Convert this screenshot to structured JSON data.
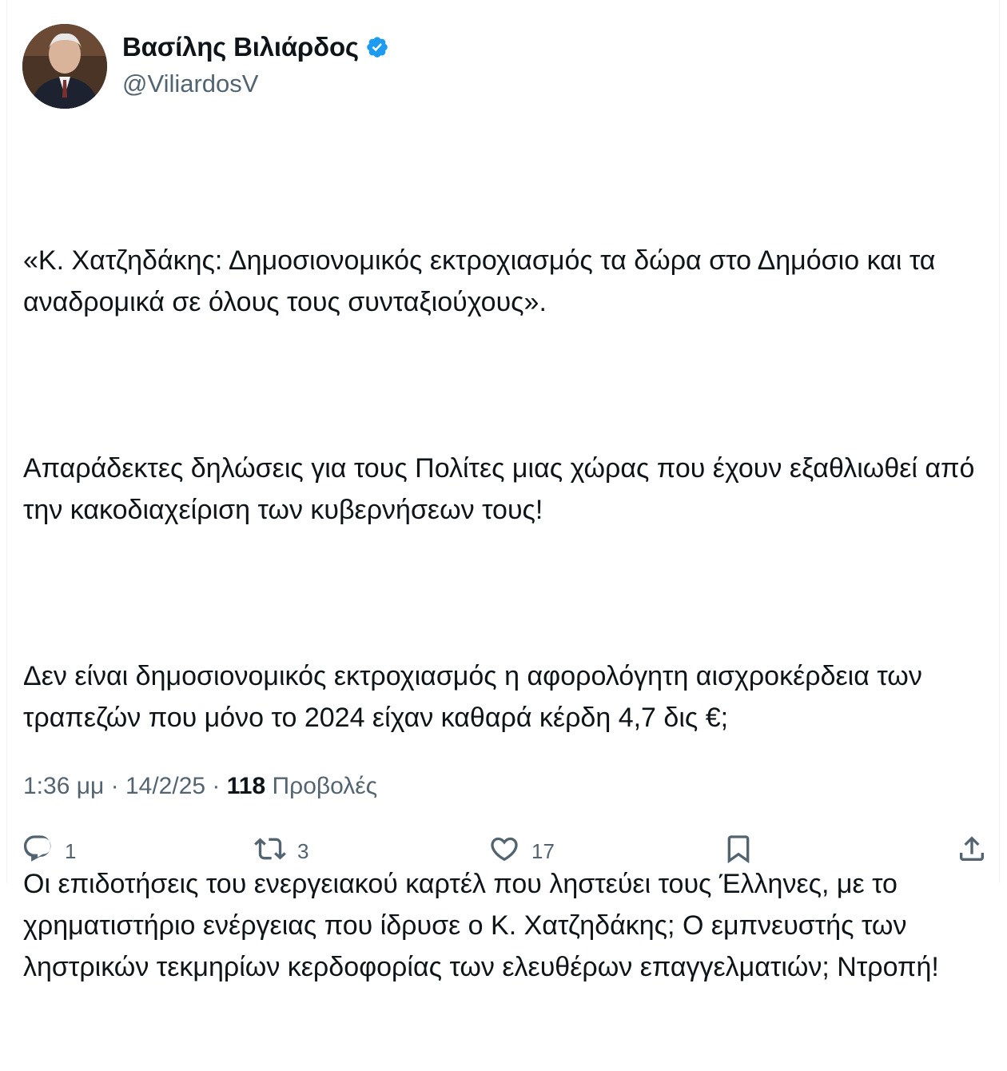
{
  "author": {
    "display_name": "Βασίλης Βιλιάρδος",
    "handle": "@ViliardosV",
    "verified": true,
    "verified_color": "#1d9bf0"
  },
  "tweet": {
    "paragraphs": [
      "«Κ. Χατζηδάκης: Δημοσιονομικός εκτροχιασμός τα δώρα στο Δημόσιο και τα αναδρομικά σε όλους τους συνταξιούχους».",
      "Απαράδεκτες δηλώσεις για τους Πολίτες μιας χώρας που έχουν εξαθλιωθεί από την κακοδιαχείριση των κυβερνήσεων τους!",
      "Δεν είναι δημοσιονομικός εκτροχιασμός η αφορολόγητη αισχροκέρδεια των τραπεζών που μόνο το 2024 είχαν καθαρά κέρδη 4,7 δις €;",
      "Οι επιδοτήσεις του ενεργειακού καρτέλ που ληστεύει τους Έλληνες, με το χρηματιστήριο ενέργειας που ίδρυσε ο Κ. Χατζηδάκης; Ο εμπνευστής των ληστρικών τεκμηρίων κερδοφορίας των ελευθέρων επαγγελματιών; Ντροπή!"
    ]
  },
  "meta": {
    "time": "1:36 μμ",
    "separator": " · ",
    "date": "14/2/25",
    "views_count": "118",
    "views_label": "Προβολές"
  },
  "actions": {
    "reply_count": "1",
    "retweet_count": "3",
    "like_count": "17"
  },
  "icons": [
    "reply-icon",
    "retweet-icon",
    "like-icon",
    "bookmark-icon",
    "share-icon",
    "verified-badge-icon"
  ]
}
